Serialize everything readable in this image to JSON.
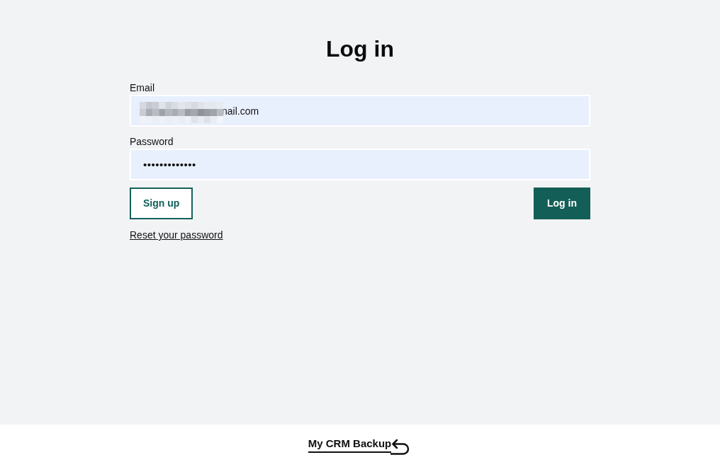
{
  "page": {
    "title": "Log in"
  },
  "form": {
    "fields": [
      {
        "kind": "email",
        "label": "Email",
        "value": "nail.com",
        "redacted": true
      },
      {
        "kind": "password",
        "label": "Password",
        "value": "•••••••••••••",
        "redacted": false
      }
    ],
    "buttons": [
      {
        "kind": "outline",
        "label": "Sign up"
      },
      {
        "kind": "primary",
        "label": "Log in"
      }
    ],
    "reset_link": "Reset your password"
  },
  "footer": {
    "logo": "My CRM Backup"
  }
}
